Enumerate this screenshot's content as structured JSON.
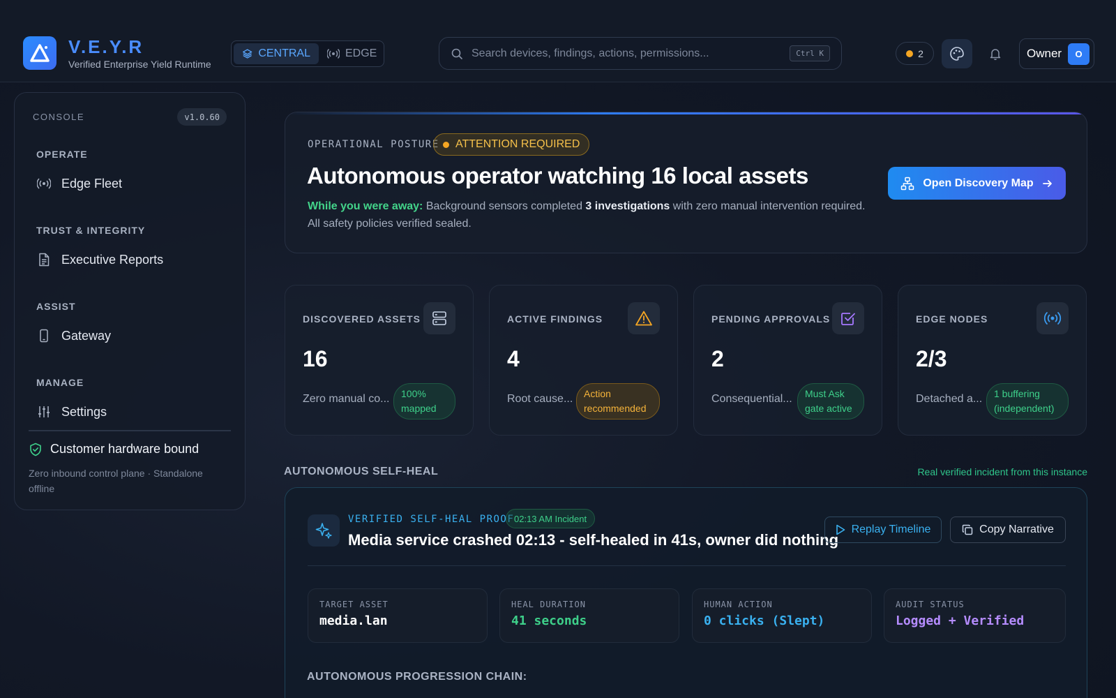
{
  "brand": {
    "name": "V.E.Y.R",
    "subtitle": "Verified Enterprise Yield Runtime"
  },
  "mode_switch": {
    "central": "CENTRAL",
    "edge": "EDGE",
    "active": "central"
  },
  "search": {
    "placeholder": "Search devices, findings, actions, permissions...",
    "shortcut": "Ctrl K"
  },
  "header": {
    "notification_count": "2",
    "owner_label": "Owner",
    "owner_initial": "O"
  },
  "sidebar": {
    "console_label": "CONSOLE",
    "version": "v1.0.60",
    "sections": [
      {
        "title": "OPERATE",
        "items": [
          {
            "label": "Edge Fleet",
            "icon": "signal-icon"
          }
        ]
      },
      {
        "title": "TRUST & INTEGRITY",
        "items": [
          {
            "label": "Executive Reports",
            "icon": "document-icon"
          }
        ]
      },
      {
        "title": "ASSIST",
        "items": [
          {
            "label": "Gateway",
            "icon": "phone-icon"
          }
        ]
      },
      {
        "title": "MANAGE",
        "items": [
          {
            "label": "Settings",
            "icon": "sliders-icon"
          }
        ]
      }
    ],
    "hardware_title": "Customer hardware bound",
    "hardware_sub": "Zero inbound control plane · Standalone offline"
  },
  "hero": {
    "label": "OPERATIONAL POSTURE",
    "status": "ATTENTION REQUIRED",
    "title": "Autonomous operator watching 16 local assets",
    "away_label": "While you were away:",
    "desc_pre": " Background sensors completed ",
    "desc_bold": "3 investigations",
    "desc_post": " with zero manual intervention required. All safety policies verified sealed.",
    "cta": "Open Discovery Map"
  },
  "stats": [
    {
      "label": "DISCOVERED ASSETS",
      "value": "16",
      "sub": "Zero manual co...",
      "badge": "100% mapped",
      "badge_tone": "green",
      "icon": "server-icon"
    },
    {
      "label": "ACTIVE FINDINGS",
      "value": "4",
      "sub": "Root cause...",
      "badge": "Action recommended",
      "badge_tone": "amber",
      "icon": "warning-icon"
    },
    {
      "label": "PENDING APPROVALS",
      "value": "2",
      "sub": "Consequential...",
      "badge": "Must Ask gate active",
      "badge_tone": "green",
      "icon": "checkbox-icon"
    },
    {
      "label": "EDGE NODES",
      "value": "2/3",
      "sub": "Detached a...",
      "badge": "1 buffering (independent)",
      "badge_tone": "green",
      "icon": "broadcast-icon"
    }
  ],
  "self_heal": {
    "section_title": "AUTONOMOUS SELF-HEAL",
    "section_link": "Real verified incident from this instance",
    "proof_label": "VERIFIED SELF-HEAL PROOF",
    "incident_time": "02:13 AM Incident",
    "headline": "Media service crashed 02:13 - self-healed in 41s, owner did nothing",
    "replay": "Replay Timeline",
    "copy": "Copy Narrative",
    "metrics": [
      {
        "label": "TARGET ASSET",
        "value": "media.lan",
        "color": "#ffffff"
      },
      {
        "label": "HEAL DURATION",
        "value": "41 seconds",
        "color": "#3ed08a"
      },
      {
        "label": "HUMAN ACTION",
        "value": "0 clicks (Slept)",
        "color": "#3ab1f0"
      },
      {
        "label": "AUDIT STATUS",
        "value": "Logged + Verified",
        "color": "#b58cff"
      }
    ],
    "chain_title": "AUTONOMOUS PROGRESSION CHAIN:"
  },
  "colors": {
    "accent": "#2e7cf6",
    "success": "#3ed08a",
    "warning": "#f5a623",
    "brand": "#4a8dff"
  }
}
